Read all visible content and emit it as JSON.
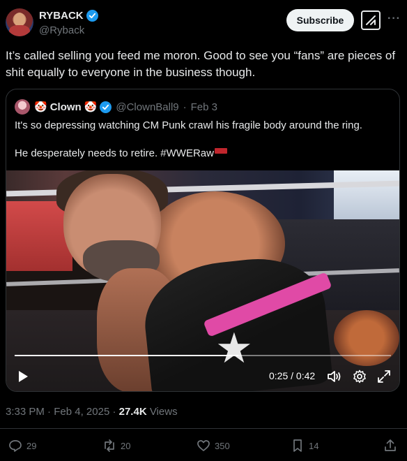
{
  "author": {
    "name": "RYBACK",
    "handle": "@Ryback",
    "verified": true
  },
  "header": {
    "subscribe_label": "Subscribe",
    "more_label": "···"
  },
  "tweet": {
    "text": "It’s called selling you feed me moron. Good to see you “fans” are pieces of shit equally to everyone in the business though."
  },
  "quote": {
    "name": "Clown",
    "emoji_before": "🤡",
    "emoji_after": "🤡",
    "handle": "@ClownBall9",
    "separator": "·",
    "date": "Feb 3",
    "line1": "It's so depressing watching CM Punk crawl his fragile body around the ring.",
    "line2": "He desperately needs to retire.",
    "hashtag": "#WWERaw",
    "video": {
      "time": "0:25 / 0:42",
      "progress_fraction": 0.595
    }
  },
  "meta": {
    "time": "3:33 PM",
    "sep1": "·",
    "date": "Feb 4, 2025",
    "sep2": "·",
    "views_count": "27.4K",
    "views_label": "Views"
  },
  "actions": {
    "replies": "29",
    "reposts": "20",
    "likes": "350",
    "bookmarks": "14"
  },
  "colors": {
    "background": "#000000",
    "text": "#e7e9ea",
    "muted": "#71767b",
    "verified": "#1d9bf0",
    "border": "#2f3336"
  }
}
